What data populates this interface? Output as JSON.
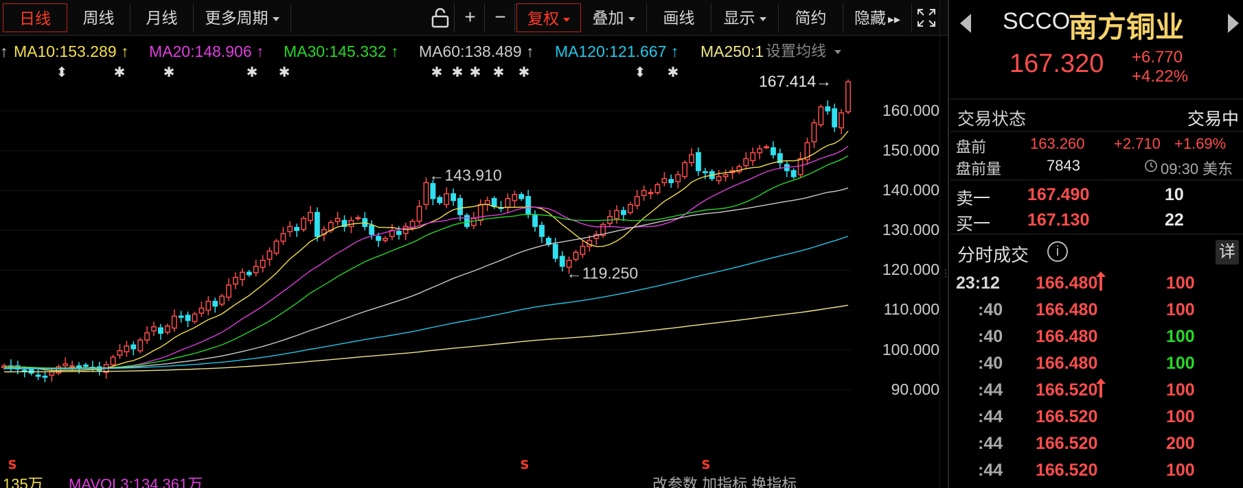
{
  "toolbar": {
    "periods": [
      "日线",
      "周线",
      "月线",
      "更多周期"
    ],
    "icons": [
      "unlock-icon",
      "zoom-in-icon",
      "zoom-out-icon"
    ],
    "adjust_label": "复权",
    "menus": [
      "叠加",
      "画线",
      "显示",
      "简约",
      "隐藏"
    ],
    "expand_icon": "fullscreen-icon"
  },
  "ma_legend": {
    "items": [
      {
        "label": "MA10:153.289",
        "color": "#f5e04a"
      },
      {
        "label": "MA20:148.906",
        "color": "#e03ee0"
      },
      {
        "label": "MA30:145.332",
        "color": "#25d826"
      },
      {
        "label": "MA60:138.489",
        "color": "#cccccc"
      },
      {
        "label": "MA120:121.667",
        "color": "#22c8e8"
      },
      {
        "label": "MA250:1",
        "color": "#f0e68c"
      }
    ],
    "settings_label": "设置均线"
  },
  "chart_data": {
    "type": "candlestick",
    "y_ticks": [
      "160.000",
      "150.000",
      "140.000",
      "130.000",
      "120.000",
      "110.000",
      "100.000",
      "90.000"
    ],
    "ylim": [
      86,
      172
    ],
    "annotations": [
      {
        "text": "167.414",
        "value": 167.414,
        "kind": "high"
      },
      {
        "text": "143.910",
        "value": 143.91,
        "kind": "local-high"
      },
      {
        "text": "119.250",
        "value": 119.25,
        "kind": "local-low"
      }
    ],
    "closes": [
      96,
      95.5,
      95.2,
      94.8,
      94.2,
      93.4,
      93.2,
      94.5,
      95.8,
      96.5,
      96.0,
      95.7,
      95.9,
      95.5,
      94.9,
      96.3,
      98.2,
      99.8,
      101.0,
      100.3,
      102.5,
      104.3,
      105.8,
      104.2,
      106.0,
      108.5,
      108.2,
      107.4,
      109.0,
      110.5,
      112.2,
      111.0,
      113.5,
      116.3,
      118.2,
      119.5,
      118.9,
      121.0,
      122.5,
      124.8,
      127.3,
      129.2,
      131.0,
      130.0,
      133.0,
      134.5,
      128.5,
      130.2,
      132.0,
      133.0,
      131.0,
      132.5,
      133.2,
      131.0,
      129.0,
      127.5,
      128.0,
      130.0,
      129.0,
      131.0,
      132.3,
      136.0,
      142.0,
      138.0,
      137.0,
      139.2,
      137.5,
      134.0,
      131.0,
      133.0,
      136.5,
      137.5,
      136.0,
      135.5,
      138.0,
      139.0,
      138.0,
      134.0,
      131.0,
      128.5,
      126.5,
      123.0,
      121.0,
      122.5,
      124.5,
      126.0,
      127.5,
      129.0,
      131.5,
      133.5,
      135.0,
      134.0,
      136.5,
      138.5,
      140.0,
      139.5,
      141.5,
      143.0,
      142.0,
      144.0,
      147.0,
      149.0,
      145.0,
      144.5,
      143.0,
      143.5,
      144.0,
      145.0,
      146.0,
      148.0,
      149.5,
      150.5,
      151.0,
      149.0,
      147.0,
      145.0,
      143.5,
      148.0,
      152.0,
      157.0,
      161.0,
      160.0,
      156.0,
      159.5,
      167.3
    ],
    "ma_series": [
      {
        "name": "MA10",
        "color": "#f5e04a"
      },
      {
        "name": "MA20",
        "color": "#e03ee0"
      },
      {
        "name": "MA30",
        "color": "#25d826"
      },
      {
        "name": "MA60",
        "color": "#cccccc"
      },
      {
        "name": "MA120",
        "color": "#22c8e8"
      },
      {
        "name": "MA250",
        "color": "#f0e68c"
      }
    ],
    "up_color": "#ff4d4d",
    "down_color": "#2fe0ef"
  },
  "bottom_strip": {
    "vol_left": "135万",
    "mavol": "MAVOL3:134.361万",
    "right": "改参数 加指标 换指标"
  },
  "panel": {
    "ticker": "SCCO",
    "name": "南方铜业",
    "price": "167.320",
    "change": "+6.770",
    "change_pct": "+4.22%",
    "status_label": "交易状态",
    "status_value": "交易中",
    "pre": {
      "label": "盘前",
      "price": "163.260",
      "change": "+2.710",
      "pct": "+1.69%",
      "vol_label": "盘前量",
      "vol": "7843",
      "time": "09:30 美东"
    },
    "ask": {
      "label": "卖一",
      "price": "167.490",
      "size": "10"
    },
    "bid": {
      "label": "买一",
      "price": "167.130",
      "size": "22"
    },
    "ticks_title": "分时成交",
    "detail_label": "详",
    "ticks": [
      {
        "time": "23:12",
        "price": "166.480",
        "vol": "100",
        "dir": "up",
        "vol_color": "#ff4d4d"
      },
      {
        "time": ":40",
        "price": "166.480",
        "vol": "100",
        "dir": "",
        "vol_color": "#ff4d4d"
      },
      {
        "time": ":40",
        "price": "166.480",
        "vol": "100",
        "dir": "",
        "vol_color": "#25d826"
      },
      {
        "time": ":40",
        "price": "166.480",
        "vol": "100",
        "dir": "",
        "vol_color": "#25d826"
      },
      {
        "time": ":44",
        "price": "166.520",
        "vol": "100",
        "dir": "up",
        "vol_color": "#ff4d4d"
      },
      {
        "time": ":44",
        "price": "166.520",
        "vol": "100",
        "dir": "",
        "vol_color": "#ff4d4d"
      },
      {
        "time": ":44",
        "price": "166.520",
        "vol": "200",
        "dir": "",
        "vol_color": "#ff4d4d"
      },
      {
        "time": ":44",
        "price": "166.520",
        "vol": "100",
        "dir": "",
        "vol_color": "#ff4d4d"
      }
    ]
  }
}
